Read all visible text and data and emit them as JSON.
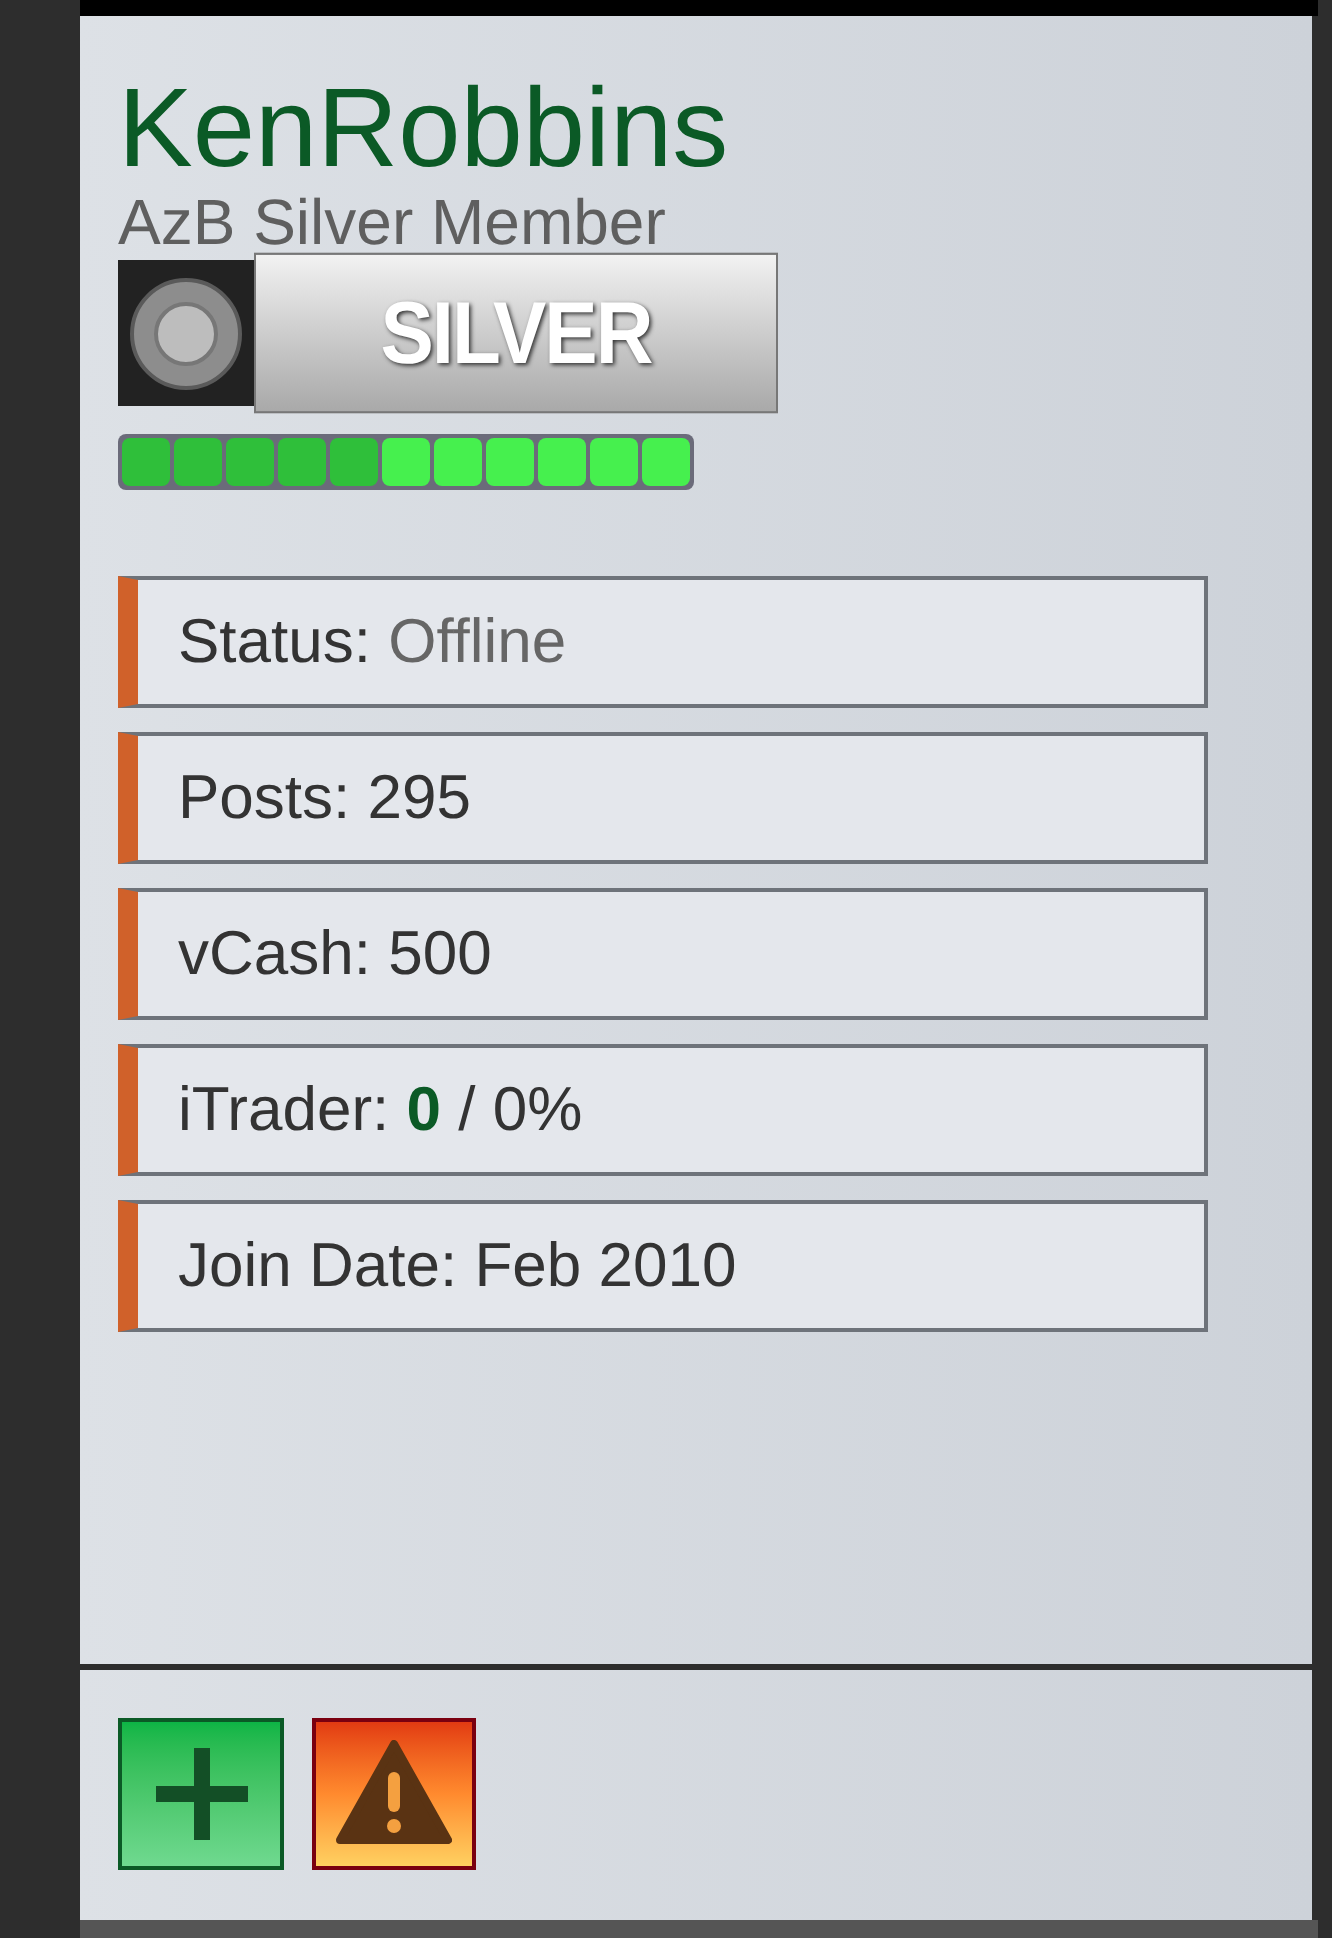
{
  "user": {
    "name": "KenRobbins",
    "title": "AzB Silver Member",
    "rank_badge": "SILVER"
  },
  "reputation": [
    {
      "kind": "pos"
    },
    {
      "kind": "pos"
    },
    {
      "kind": "pos"
    },
    {
      "kind": "pos"
    },
    {
      "kind": "pos"
    },
    {
      "kind": "high"
    },
    {
      "kind": "high"
    },
    {
      "kind": "high"
    },
    {
      "kind": "high"
    },
    {
      "kind": "high"
    },
    {
      "kind": "high"
    }
  ],
  "stats": [
    {
      "kind": "status",
      "label": "Status:",
      "value": "Offline"
    },
    {
      "kind": "plain",
      "label": "Posts:",
      "value": "295"
    },
    {
      "kind": "plain",
      "label": "vCash:",
      "value": "500"
    },
    {
      "kind": "itrader",
      "label": "iTrader:",
      "value": "0",
      "suffix": "/ 0%"
    },
    {
      "kind": "plain",
      "label": "Join Date:",
      "value": "Feb 2010"
    }
  ],
  "actions": [
    {
      "kind": "add"
    },
    {
      "kind": "report"
    }
  ]
}
